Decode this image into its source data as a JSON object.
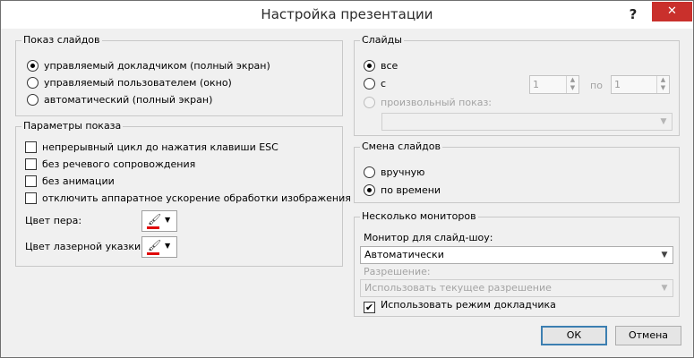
{
  "window": {
    "title": "Настройка презентации",
    "help_label": "?",
    "close_label": "✕"
  },
  "show_type": {
    "legend": "Показ слайдов",
    "options": [
      {
        "label": "управляемый докладчиком (полный экран)",
        "selected": true
      },
      {
        "label": "управляемый пользователем (окно)",
        "selected": false
      },
      {
        "label": "автоматический (полный экран)",
        "selected": false
      }
    ]
  },
  "show_options": {
    "legend": "Параметры показа",
    "checks": [
      {
        "label": "непрерывный цикл до нажатия клавиши ESC",
        "checked": false
      },
      {
        "label": "без речевого сопровождения",
        "checked": false
      },
      {
        "label": "без анимации",
        "checked": false
      },
      {
        "label": "отключить аппаратное ускорение обработки изображения",
        "checked": false
      }
    ],
    "pen_color_label": "Цвет пера:",
    "laser_color_label": "Цвет лазерной указки:",
    "pen_color": "#e00000",
    "laser_color": "#e00000"
  },
  "slides": {
    "legend": "Слайды",
    "all_label": "все",
    "from_label": "с",
    "from_value": "1",
    "to_label": "по",
    "to_value": "1",
    "custom_label": "произвольный показ:",
    "custom_value": ""
  },
  "advance": {
    "legend": "Смена слайдов",
    "manual_label": "вручную",
    "timed_label": "по времени",
    "selected": "timed"
  },
  "monitors": {
    "legend": "Несколько мониторов",
    "monitor_label": "Монитор для слайд-шоу:",
    "monitor_value": "Автоматически",
    "resolution_label": "Разрешение:",
    "resolution_value": "Использовать текущее разрешение",
    "presenter_view_label": "Использовать режим докладчика",
    "presenter_view_checked": true
  },
  "buttons": {
    "ok": "ОК",
    "cancel": "Отмена"
  }
}
